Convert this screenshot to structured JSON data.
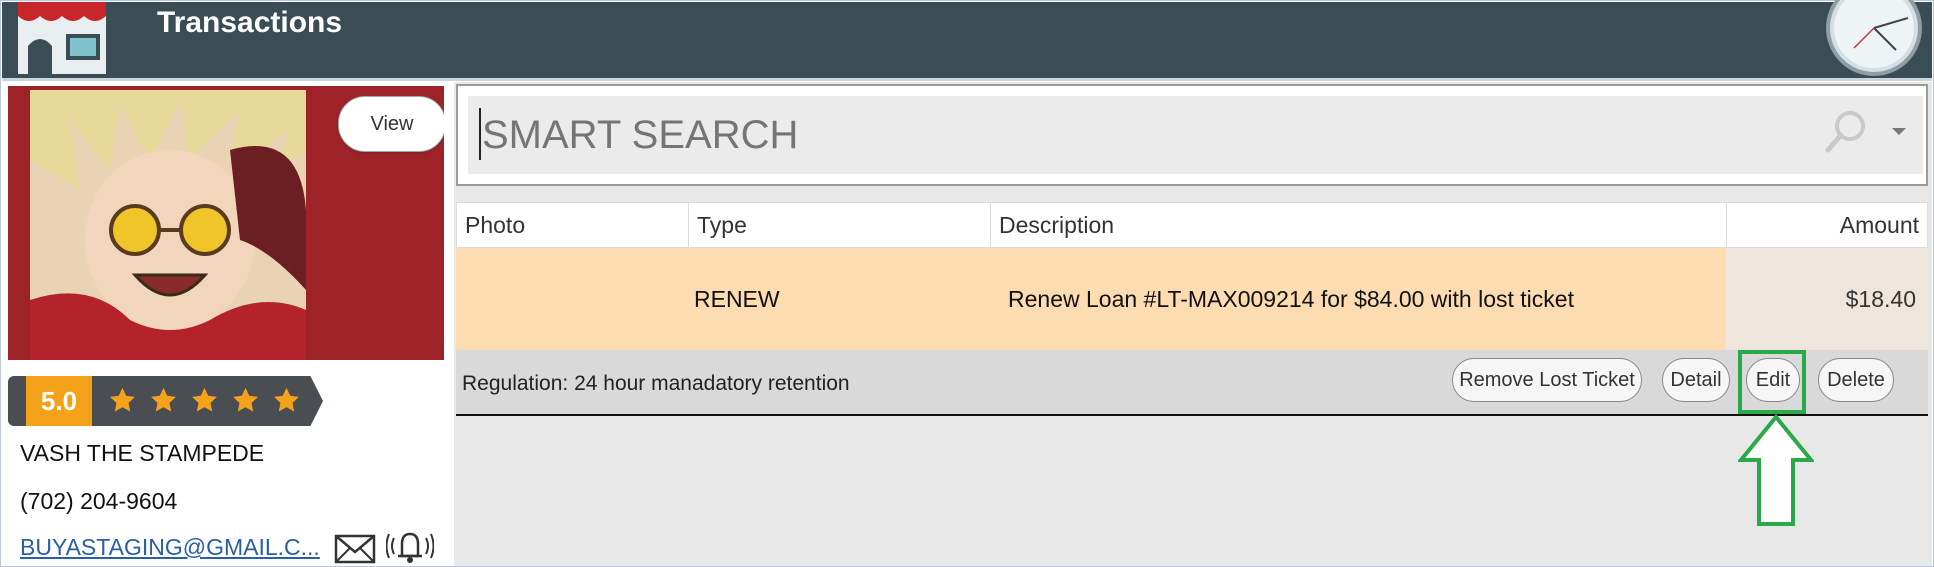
{
  "header": {
    "title": "Transactions"
  },
  "customer": {
    "view_label": "View",
    "rating": "5.0",
    "stars": 5,
    "name": "VASH THE STAMPEDE",
    "phone": "(702) 204-9604",
    "email": "BUYASTAGING@GMAIL.C..."
  },
  "search": {
    "placeholder": "SMART SEARCH"
  },
  "table": {
    "columns": [
      "Photo",
      "Type",
      "Description",
      "Amount"
    ],
    "rows": [
      {
        "photo": "",
        "type": "RENEW",
        "description": "Renew Loan #LT-MAX009214 for $84.00 with lost ticket",
        "amount": "$18.40"
      }
    ],
    "regulation": "Regulation: 24 hour manadatory retention",
    "actions": {
      "remove_lost_ticket": "Remove Lost Ticket",
      "detail": "Detail",
      "edit": "Edit",
      "delete": "Delete"
    }
  },
  "colors": {
    "header_bg": "#3a4d55",
    "row_highlight": "#fddcb2",
    "rating_badge": "#f5a21b",
    "annotation": "#2aa84a"
  },
  "icons": [
    "store-icon",
    "clock-icon",
    "star-icon",
    "mail-icon",
    "bell-icon",
    "search-icon",
    "chevron-down-icon",
    "arrow-up-icon"
  ]
}
